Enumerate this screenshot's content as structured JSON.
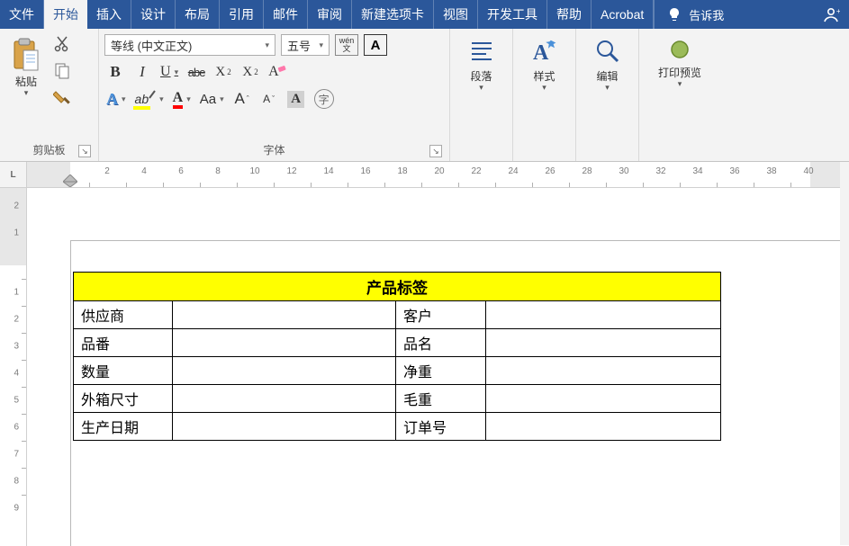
{
  "tabs": {
    "file": "文件",
    "home": "开始",
    "insert": "插入",
    "design": "设计",
    "layout": "布局",
    "references": "引用",
    "mailings": "邮件",
    "review": "审阅",
    "newtab": "新建选项卡",
    "view": "视图",
    "developer": "开发工具",
    "help": "帮助",
    "acrobat": "Acrobat",
    "tellme": "告诉我"
  },
  "ribbon": {
    "clipboard": {
      "label": "剪贴板",
      "paste": "粘贴"
    },
    "font": {
      "label": "字体",
      "name": "等线 (中文正文)",
      "size": "五号",
      "wen_top": "wén",
      "wen_bot": "文",
      "A": "A"
    },
    "paragraph": {
      "label": "段落"
    },
    "styles": {
      "label": "样式"
    },
    "editing": {
      "label": "编辑"
    },
    "printpreview": {
      "label": "打印预览"
    }
  },
  "ruler": {
    "h": [
      "2",
      "4",
      "6",
      "8",
      "10",
      "12",
      "14",
      "16",
      "18",
      "20",
      "22",
      "24",
      "26",
      "28",
      "30",
      "32",
      "34",
      "36",
      "38",
      "40"
    ],
    "v_neg": [
      "2",
      "1"
    ],
    "v_pos": [
      "1",
      "2",
      "3",
      "4",
      "5",
      "6",
      "7",
      "8",
      "9"
    ]
  },
  "doc": {
    "title": "产品标签",
    "rows": [
      {
        "l1": "供应商",
        "l2": "客户"
      },
      {
        "l1": "品番",
        "l2": "品名"
      },
      {
        "l1": "数量",
        "l2": "净重"
      },
      {
        "l1": "外箱尺寸",
        "l2": "毛重"
      },
      {
        "l1": "生产日期",
        "l2": "订单号"
      }
    ]
  }
}
